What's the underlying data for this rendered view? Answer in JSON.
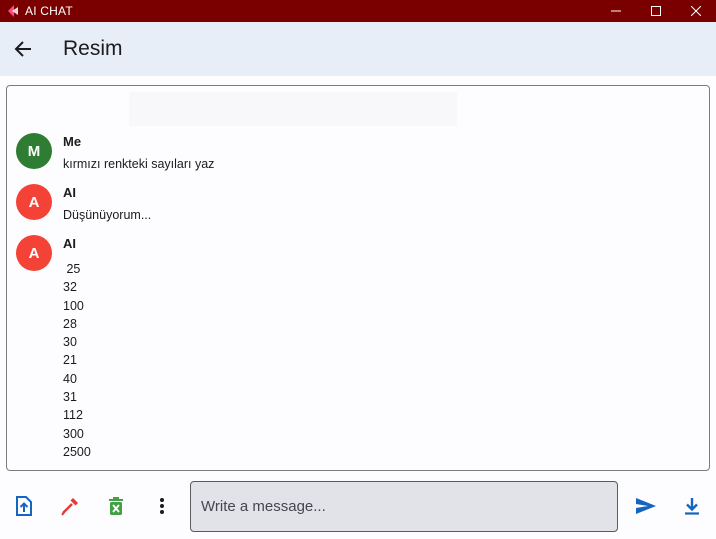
{
  "window": {
    "title": "AI CHAT"
  },
  "appbar": {
    "title": "Resim"
  },
  "messages": [
    {
      "avatar": "M",
      "avatar_color": "#2e7d32",
      "sender": "Me",
      "text": "kırmızı renkteki sayıları yaz"
    },
    {
      "avatar": "A",
      "avatar_color": "#f44336",
      "sender": "AI",
      "text": "Düşünüyorum..."
    },
    {
      "avatar": "A",
      "avatar_color": "#f44336",
      "sender": "AI",
      "lines": [
        " 25",
        "32",
        "100",
        "28",
        "30",
        "21",
        "40",
        "31",
        "112",
        "300",
        "2500"
      ]
    }
  ],
  "composer": {
    "placeholder": "Write a message..."
  },
  "icons": {
    "upload": "upload-file-icon",
    "color_picker": "color-picker-icon",
    "delete": "delete-excel-icon",
    "more": "more-vert-icon",
    "send": "send-icon",
    "download": "download-icon"
  },
  "colors": {
    "titlebar": "#7a0000",
    "appbar": "#e8eef7",
    "accent": "#1565c0",
    "picker": "#e53935",
    "delete": "#43a047"
  }
}
